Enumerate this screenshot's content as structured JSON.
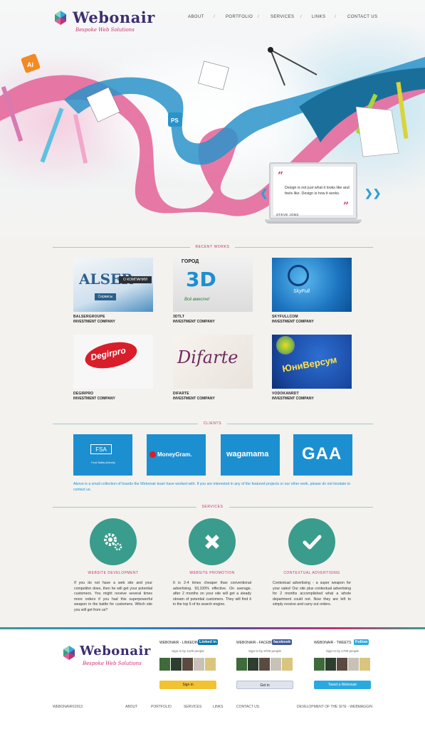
{
  "brand": {
    "name": "Webonair",
    "tagline": "Bespoke Web Solutions",
    "colors": {
      "purple": "#3c2f6e",
      "magenta": "#d0306f",
      "blue": "#1c8fd1",
      "teal": "#3a9c8c"
    }
  },
  "nav": {
    "items": [
      "About",
      "Portfolio",
      "Services",
      "Links",
      "Contact us"
    ],
    "separator": "/"
  },
  "hero": {
    "icons": [
      "ai-icon",
      "ps-icon",
      "pencil-icon",
      "compass-icon",
      "paper-note-icon"
    ],
    "quote": {
      "text": "Design is not just what it looks like and feels like. Design is how it works.",
      "author": "STEVE JOBS"
    },
    "prev_arrow": "❮❮",
    "next_arrow": "❯❯"
  },
  "recent_works": {
    "title": "RECENT WORKS",
    "items": [
      {
        "name": "BALSERGROUPE",
        "category": "INVESTMENT COMPANY",
        "thumb_text": "ALSER",
        "thumb_sub": "О КОМПАНИИ",
        "thumb_btn": "Сервисы"
      },
      {
        "name": "3DTLT",
        "category": "INVESTMENT COMPANY",
        "thumb_text": "3D",
        "thumb_sub": "ГОРОД",
        "thumb_btn": "Всё вместе!"
      },
      {
        "name": "SKYFULLCOM",
        "category": "INVESTMENT COMPANY",
        "thumb_text": "SkyFull",
        "thumb_sub": "",
        "thumb_btn": ""
      },
      {
        "name": "DEGIRPRO",
        "category": "INVESTMENT COMPANY",
        "thumb_text": "Degirpro",
        "thumb_sub": "",
        "thumb_btn": ""
      },
      {
        "name": "DIFARTE",
        "category": "INVESTMENT COMPANY",
        "thumb_text": "Difarte",
        "thumb_sub": "",
        "thumb_btn": ""
      },
      {
        "name": "VODOKANRDT",
        "category": "INVESTMENT COMPANY",
        "thumb_text": "ЮниВерсум",
        "thumb_sub": "",
        "thumb_btn": ""
      }
    ]
  },
  "clients": {
    "title": "CLIENTS",
    "items": [
      {
        "name": "FSA",
        "sub": "Food Safety Authority"
      },
      {
        "name": "MoneyGram."
      },
      {
        "name": "wagamama"
      },
      {
        "name": "GAA"
      }
    ],
    "note": "Above is a small collection of brands the Webonair team have worked with. If you are interested in any of the featured projects or our other work, please do not hesitate to contact us."
  },
  "services": {
    "title": "SERVICES",
    "items": [
      {
        "title": "WEBSITE DEVELOPMENT",
        "icon": "gears-icon",
        "text": "If you do not have a web site and your competitor does, then he will get your potential customers. You might receive several times more orders if you had this superpowerful weapon in the battle for customers. Which site you will get from us?"
      },
      {
        "title": "WEBSITE PROMOTION",
        "icon": "ruler-pencil-icon",
        "text": "It is 2-4 times cheaper than conventional advertising. 93,100% effective. On average, after 2 months on your site will get a steady stream of potential customers. They will find it in the top 5 of its search engine."
      },
      {
        "title": "CONTEXTUAL ADVERTISING",
        "icon": "check-icon",
        "text": "Contextual advertising - a super weapon for your sales! Our site plus contextual advertising for 2 months accomplished what a whole department could not. Now they are left to simply receive and carry out orders."
      }
    ]
  },
  "footer": {
    "social": [
      {
        "head": "WEBONAIR - LINKEDIN",
        "brand": "Linked in",
        "brand_color": "#0e76a8",
        "sub": "Sign In by 1100 people",
        "button": "Sign in",
        "button_color": "#f1c232"
      },
      {
        "head": "WEBONAIR - FACEBOOK",
        "brand": "facebook",
        "brand_color": "#3b5998",
        "sub": "Sign In by 3700 people",
        "button": "Get in",
        "button_color": "#dfe3ee"
      },
      {
        "head": "WEBONAIR - TWEETS",
        "brand": "Follow",
        "brand_color": "#2aa9e0",
        "sub": "Sign In by 1700 people",
        "button": "Tweet a Webonair",
        "button_color": "#2aa9e0"
      }
    ],
    "copyright": "WEBONAIR©2013",
    "links": [
      "About",
      "Portfolio",
      "Services",
      "Links",
      "Contact us"
    ],
    "credit": "DEVELOPMENT OF THE SITE - WEBMAGGIN"
  }
}
